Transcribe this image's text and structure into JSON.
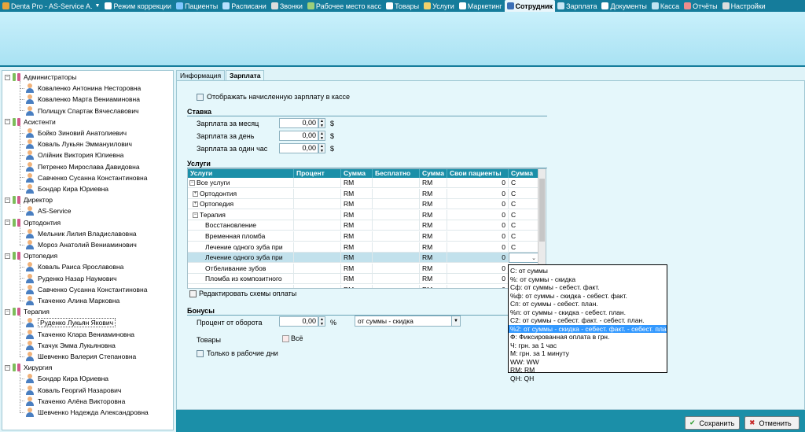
{
  "menubar": {
    "items": [
      {
        "label": "Denta Pro - AS-Service A.",
        "icon": "app-icon",
        "color": "#e8a43c",
        "dropdown": "▼"
      },
      {
        "label": "Режим коррекции",
        "icon": "edit-icon",
        "color": "#ffffff"
      },
      {
        "label": "Пациенты",
        "icon": "patients-icon",
        "color": "#7fc7ff"
      },
      {
        "label": "Расписани",
        "icon": "schedule-icon",
        "color": "#b8e0ff"
      },
      {
        "label": "Звонки",
        "icon": "phone-icon",
        "color": "#dddddd"
      },
      {
        "label": "Рабочее место касс",
        "icon": "cashier-icon",
        "color": "#9ccf7a"
      },
      {
        "label": "Товары",
        "icon": "goods-icon",
        "color": "#ffffff"
      },
      {
        "label": "Услуги",
        "icon": "services-icon",
        "color": "#f2d16b"
      },
      {
        "label": "Маркетинг",
        "icon": "marketing-icon",
        "color": "#ffffff"
      },
      {
        "label": "Сотрудник",
        "icon": "employee-icon",
        "color": "#3b6fb6",
        "active": true
      },
      {
        "label": "Зарплата",
        "icon": "salary-icon",
        "color": "#c8e6f5"
      },
      {
        "label": "Документы",
        "icon": "documents-icon",
        "color": "#ffffff"
      },
      {
        "label": "Касса",
        "icon": "cashbox-icon",
        "color": "#bfe3f2"
      },
      {
        "label": "Отчёты",
        "icon": "reports-icon",
        "color": "#f08c8c"
      },
      {
        "label": "Настройки",
        "icon": "settings-icon",
        "color": "#dddddd"
      }
    ]
  },
  "tree": {
    "groups": [
      {
        "label": "Администраторы",
        "members": [
          "Коваленко Антонина Несторовна",
          "Коваленко Марта Вениаминовна",
          "Полищук Спартак Вячеславович"
        ]
      },
      {
        "label": "Асистенти",
        "members": [
          "Бойко Зиновий Анатолиевич",
          "Коваль Лукьян Эммануилович",
          "Олійник Виктория Юлиевна",
          "Петренко Мирослава Давидовна",
          "Савченко Сусанна Константиновна",
          "Бондар Кира Юриевна"
        ]
      },
      {
        "label": "Директор",
        "members": [
          "AS-Service"
        ]
      },
      {
        "label": "Ортодонтия",
        "members": [
          "Мельник Лилия Владиславовна",
          "Мороз Анатолий Вениаминович"
        ]
      },
      {
        "label": "Ортопедия",
        "members": [
          "Коваль Раиса Ярославовна",
          "Руденко Назар Наумович",
          "Савченко Сусанна Константиновна",
          "Ткаченко Алина Марковна"
        ]
      },
      {
        "label": "Терапия",
        "members": [
          "Руденко Лукьян Якович",
          "Ткаченко Клара Вениаминовна",
          "Ткачук Эмма Лукьяновна",
          "Шевченко Валерия Степановна"
        ]
      },
      {
        "label": "Хирургия",
        "members": [
          "Бондар Кира Юриевна",
          "Коваль Георгий Назарович",
          "Ткаченко Алёна Викторовна",
          "Шевченко Надежда Александровна"
        ]
      }
    ],
    "expander": "−",
    "selected": "Руденко Лукьян Якович"
  },
  "tabs": [
    {
      "label": "Информация"
    },
    {
      "label": "Зарплата",
      "active": true
    }
  ],
  "salary": {
    "show_in_cash_label": "Отображать начисленную зарплату в кассе",
    "rate_section": "Ставка",
    "rate_rows": [
      {
        "label": "Зарплата за месяц",
        "value": "0,00",
        "unit": "$"
      },
      {
        "label": "Зарплата за день",
        "value": "0,00",
        "unit": "$"
      },
      {
        "label": "Зарплата за один час",
        "value": "0,00",
        "unit": "$"
      }
    ],
    "services_section": "Услуги",
    "edit_schemes_label": "Редактировать схемы оплаты",
    "bonuses_section": "Бонусы",
    "percent_label": "Процент от оборота",
    "percent_value": "0,00",
    "percent_unit": "%",
    "percent_mode": "от суммы - скидка",
    "goods_label": "Товары",
    "goods_value": "Всё",
    "workdays_label": "Только в рабочие дни"
  },
  "grid": {
    "columns": [
      "Услуги",
      "Процент",
      "Сумма",
      "Бесплатно",
      "Сумма",
      "Свои пациенты",
      "Сумма"
    ],
    "rows": [
      {
        "name": "Все услуги",
        "prefix": "−",
        "indent": 0,
        "c1": "",
        "c2": "RM",
        "c3": "",
        "c4": "RM",
        "c5": "0",
        "c6": "C"
      },
      {
        "name": "Ортодонтия",
        "prefix": "+",
        "indent": 1,
        "c1": "",
        "c2": "RM",
        "c3": "",
        "c4": "RM",
        "c5": "0",
        "c6": "C"
      },
      {
        "name": "Ортопедия",
        "prefix": "+",
        "indent": 1,
        "c1": "",
        "c2": "RM",
        "c3": "",
        "c4": "RM",
        "c5": "0",
        "c6": "C"
      },
      {
        "name": "Терапия",
        "prefix": "−",
        "indent": 1,
        "c1": "",
        "c2": "RM",
        "c3": "",
        "c4": "RM",
        "c5": "0",
        "c6": "C"
      },
      {
        "name": "Восстановление",
        "prefix": "",
        "indent": 2,
        "c1": "",
        "c2": "RM",
        "c3": "",
        "c4": "RM",
        "c5": "0",
        "c6": "C"
      },
      {
        "name": "Временная пломба",
        "prefix": "",
        "indent": 2,
        "c1": "",
        "c2": "RM",
        "c3": "",
        "c4": "RM",
        "c5": "0",
        "c6": "C"
      },
      {
        "name": "Лечение одного зуба при",
        "prefix": "",
        "indent": 2,
        "c1": "",
        "c2": "RM",
        "c3": "",
        "c4": "RM",
        "c5": "0",
        "c6": "C"
      },
      {
        "name": "Лечение одного зуба при",
        "prefix": "",
        "indent": 2,
        "c1": "",
        "c2": "RM",
        "c3": "",
        "c4": "RM",
        "c5": "0",
        "c6": "",
        "highlight": true
      },
      {
        "name": "Отбеливание зубов",
        "prefix": "",
        "indent": 2,
        "c1": "",
        "c2": "RM",
        "c3": "",
        "c4": "RM",
        "c5": "0",
        "c6": ""
      },
      {
        "name": "Пломба из композитного",
        "prefix": "",
        "indent": 2,
        "c1": "",
        "c2": "RM",
        "c3": "",
        "c4": "RM",
        "c5": "0",
        "c6": ""
      },
      {
        "name": "",
        "prefix": "",
        "indent": 2,
        "c1": "",
        "c2": "RM",
        "c3": "",
        "c4": "RM",
        "c5": "0",
        "c6": ""
      }
    ]
  },
  "popup": {
    "items": [
      "С: от суммы",
      "%: от суммы - скидка",
      "Сф: от суммы - себест. факт.",
      "%ф: от суммы - скидка - себест. факт.",
      "Сп: от суммы - себест. план.",
      "%п: от суммы - скидка - себест. план.",
      "С2: от суммы - себест. факт. - себест. план.",
      "%2: от суммы - скидка - себест. факт. - себест. план.",
      "Ф: Фиксированная оплата в грн.",
      "Ч: грн. за 1 час",
      "М: грн. за 1 минуту",
      "WW: WW",
      "RM: RM",
      "QH: QH"
    ],
    "active_index": 7
  },
  "footer": {
    "save_label": "Сохранить",
    "cancel_label": "Отменить"
  },
  "colors": {
    "accent": "#157c9b",
    "header_row": "#1b8fa8",
    "selection": "#3399ff",
    "panel_bg": "#e5f7fb"
  }
}
